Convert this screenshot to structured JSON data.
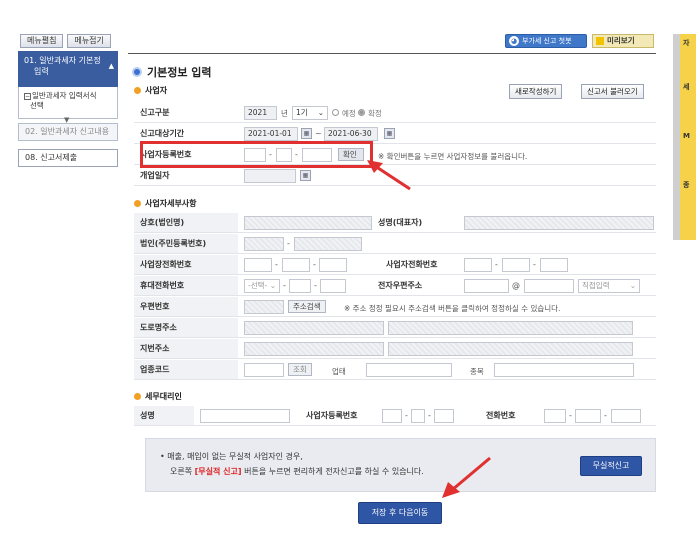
{
  "sidebar": {
    "top_buttons": [
      "메뉴펼침",
      "메뉴접기"
    ],
    "menu1_lines": [
      "01. 일반과세자 기본정",
      "입력"
    ],
    "menu1_sub_lines": [
      "일반과세자 입력서식",
      "선택"
    ],
    "menu2": "02. 일반과세자 신고내용",
    "menu3": "08. 신고서제출"
  },
  "toolbar": {
    "notice_label": "부가세 신고 첫봇",
    "preview_label": "미리보기"
  },
  "right_strip": [
    "자",
    "세",
    "M",
    "종"
  ],
  "headings": {
    "main": "기본정보 입력",
    "business": "사업자",
    "business_detail": "사업자세부사항",
    "tax_agent": "세무대리인"
  },
  "business": {
    "new_write_label": "새로작성하기",
    "load_label": "신고서 불러오기",
    "report_type_label": "신고구분",
    "year_value": "2021",
    "year_unit": "년",
    "period_select": "1기",
    "radio_scheduled": "예정",
    "radio_final": "확정",
    "period_label": "신고대상기간",
    "period_start": "2021-01-01",
    "period_end": "2021-06-30",
    "reg_no_label": "사업자등록번호",
    "confirm_label": "확인",
    "reg_note": "※ 확인버튼을 누르면 사업자정보를 불러옵니다.",
    "open_date_label": "개업일자"
  },
  "detail": {
    "company_label": "상호(법인명)",
    "ceo_label": "성명(대표자)",
    "corp_no_label": "법인(주민등록번호)",
    "phone_label": "사업장전화번호",
    "home_phone_label": "사업자전화번호",
    "mobile_label": "휴대전화번호",
    "mobile_select": "-선택-",
    "email_label": "전자우편주소",
    "email_at": "@",
    "email_domain": "직접입력",
    "zip_label": "우편번호",
    "addr_search_label": "주소검색",
    "zip_note": "※ 주소 정정 필요시 주소검색 버튼을 클릭하여 정정하실 수 있습니다.",
    "road_addr_label": "도로명주소",
    "lot_addr_label": "지번주소",
    "industry_label": "업종코드",
    "lookup_label": "조회",
    "business_type_label": "업태",
    "item_label": "종목"
  },
  "agent": {
    "name_label": "성명",
    "reg_no_label": "사업자등록번호",
    "phone_label": "전화번호"
  },
  "panel": {
    "line1": "• 매출, 매입이 없는 무실적 사업자인 경우,",
    "line2_prefix": "오른쪽",
    "line2_red": "[무실적 신고]",
    "line2_suffix": "버튼을 누르면 편리하게 전자신고를 하실 수 있습니다.",
    "nil_report_label": "무실적신고"
  },
  "save_next_label": "저장 후 다음이동",
  "colors": {
    "highlight": "#e0302f",
    "primary": "#2f55a5",
    "sidebar_active": "#3a5d9f",
    "accent_yellow": "#f6d24a"
  }
}
